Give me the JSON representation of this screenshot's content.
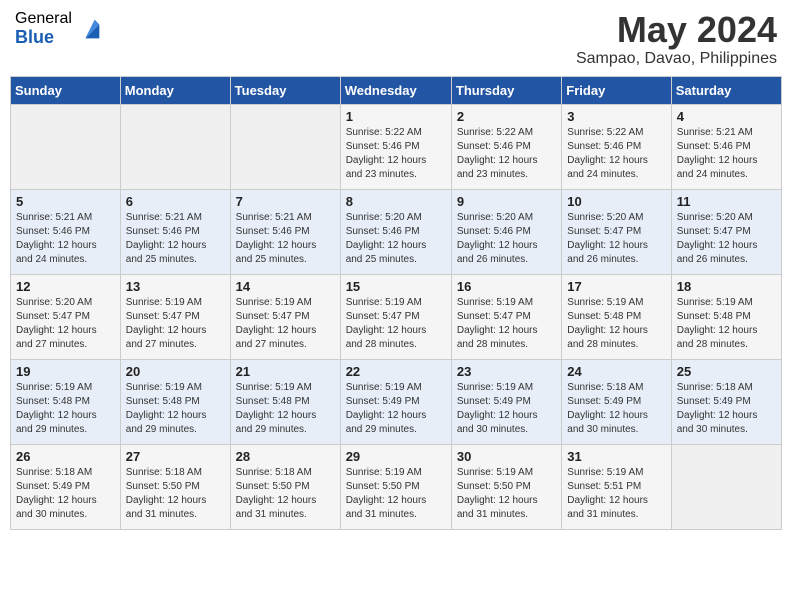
{
  "header": {
    "logo_general": "General",
    "logo_blue": "Blue",
    "month_title": "May 2024",
    "location": "Sampao, Davao, Philippines"
  },
  "weekdays": [
    "Sunday",
    "Monday",
    "Tuesday",
    "Wednesday",
    "Thursday",
    "Friday",
    "Saturday"
  ],
  "weeks": [
    [
      {
        "day": "",
        "info": ""
      },
      {
        "day": "",
        "info": ""
      },
      {
        "day": "",
        "info": ""
      },
      {
        "day": "1",
        "info": "Sunrise: 5:22 AM\nSunset: 5:46 PM\nDaylight: 12 hours\nand 23 minutes."
      },
      {
        "day": "2",
        "info": "Sunrise: 5:22 AM\nSunset: 5:46 PM\nDaylight: 12 hours\nand 23 minutes."
      },
      {
        "day": "3",
        "info": "Sunrise: 5:22 AM\nSunset: 5:46 PM\nDaylight: 12 hours\nand 24 minutes."
      },
      {
        "day": "4",
        "info": "Sunrise: 5:21 AM\nSunset: 5:46 PM\nDaylight: 12 hours\nand 24 minutes."
      }
    ],
    [
      {
        "day": "5",
        "info": "Sunrise: 5:21 AM\nSunset: 5:46 PM\nDaylight: 12 hours\nand 24 minutes."
      },
      {
        "day": "6",
        "info": "Sunrise: 5:21 AM\nSunset: 5:46 PM\nDaylight: 12 hours\nand 25 minutes."
      },
      {
        "day": "7",
        "info": "Sunrise: 5:21 AM\nSunset: 5:46 PM\nDaylight: 12 hours\nand 25 minutes."
      },
      {
        "day": "8",
        "info": "Sunrise: 5:20 AM\nSunset: 5:46 PM\nDaylight: 12 hours\nand 25 minutes."
      },
      {
        "day": "9",
        "info": "Sunrise: 5:20 AM\nSunset: 5:46 PM\nDaylight: 12 hours\nand 26 minutes."
      },
      {
        "day": "10",
        "info": "Sunrise: 5:20 AM\nSunset: 5:47 PM\nDaylight: 12 hours\nand 26 minutes."
      },
      {
        "day": "11",
        "info": "Sunrise: 5:20 AM\nSunset: 5:47 PM\nDaylight: 12 hours\nand 26 minutes."
      }
    ],
    [
      {
        "day": "12",
        "info": "Sunrise: 5:20 AM\nSunset: 5:47 PM\nDaylight: 12 hours\nand 27 minutes."
      },
      {
        "day": "13",
        "info": "Sunrise: 5:19 AM\nSunset: 5:47 PM\nDaylight: 12 hours\nand 27 minutes."
      },
      {
        "day": "14",
        "info": "Sunrise: 5:19 AM\nSunset: 5:47 PM\nDaylight: 12 hours\nand 27 minutes."
      },
      {
        "day": "15",
        "info": "Sunrise: 5:19 AM\nSunset: 5:47 PM\nDaylight: 12 hours\nand 28 minutes."
      },
      {
        "day": "16",
        "info": "Sunrise: 5:19 AM\nSunset: 5:47 PM\nDaylight: 12 hours\nand 28 minutes."
      },
      {
        "day": "17",
        "info": "Sunrise: 5:19 AM\nSunset: 5:48 PM\nDaylight: 12 hours\nand 28 minutes."
      },
      {
        "day": "18",
        "info": "Sunrise: 5:19 AM\nSunset: 5:48 PM\nDaylight: 12 hours\nand 28 minutes."
      }
    ],
    [
      {
        "day": "19",
        "info": "Sunrise: 5:19 AM\nSunset: 5:48 PM\nDaylight: 12 hours\nand 29 minutes."
      },
      {
        "day": "20",
        "info": "Sunrise: 5:19 AM\nSunset: 5:48 PM\nDaylight: 12 hours\nand 29 minutes."
      },
      {
        "day": "21",
        "info": "Sunrise: 5:19 AM\nSunset: 5:48 PM\nDaylight: 12 hours\nand 29 minutes."
      },
      {
        "day": "22",
        "info": "Sunrise: 5:19 AM\nSunset: 5:49 PM\nDaylight: 12 hours\nand 29 minutes."
      },
      {
        "day": "23",
        "info": "Sunrise: 5:19 AM\nSunset: 5:49 PM\nDaylight: 12 hours\nand 30 minutes."
      },
      {
        "day": "24",
        "info": "Sunrise: 5:18 AM\nSunset: 5:49 PM\nDaylight: 12 hours\nand 30 minutes."
      },
      {
        "day": "25",
        "info": "Sunrise: 5:18 AM\nSunset: 5:49 PM\nDaylight: 12 hours\nand 30 minutes."
      }
    ],
    [
      {
        "day": "26",
        "info": "Sunrise: 5:18 AM\nSunset: 5:49 PM\nDaylight: 12 hours\nand 30 minutes."
      },
      {
        "day": "27",
        "info": "Sunrise: 5:18 AM\nSunset: 5:50 PM\nDaylight: 12 hours\nand 31 minutes."
      },
      {
        "day": "28",
        "info": "Sunrise: 5:18 AM\nSunset: 5:50 PM\nDaylight: 12 hours\nand 31 minutes."
      },
      {
        "day": "29",
        "info": "Sunrise: 5:19 AM\nSunset: 5:50 PM\nDaylight: 12 hours\nand 31 minutes."
      },
      {
        "day": "30",
        "info": "Sunrise: 5:19 AM\nSunset: 5:50 PM\nDaylight: 12 hours\nand 31 minutes."
      },
      {
        "day": "31",
        "info": "Sunrise: 5:19 AM\nSunset: 5:51 PM\nDaylight: 12 hours\nand 31 minutes."
      },
      {
        "day": "",
        "info": ""
      }
    ]
  ]
}
